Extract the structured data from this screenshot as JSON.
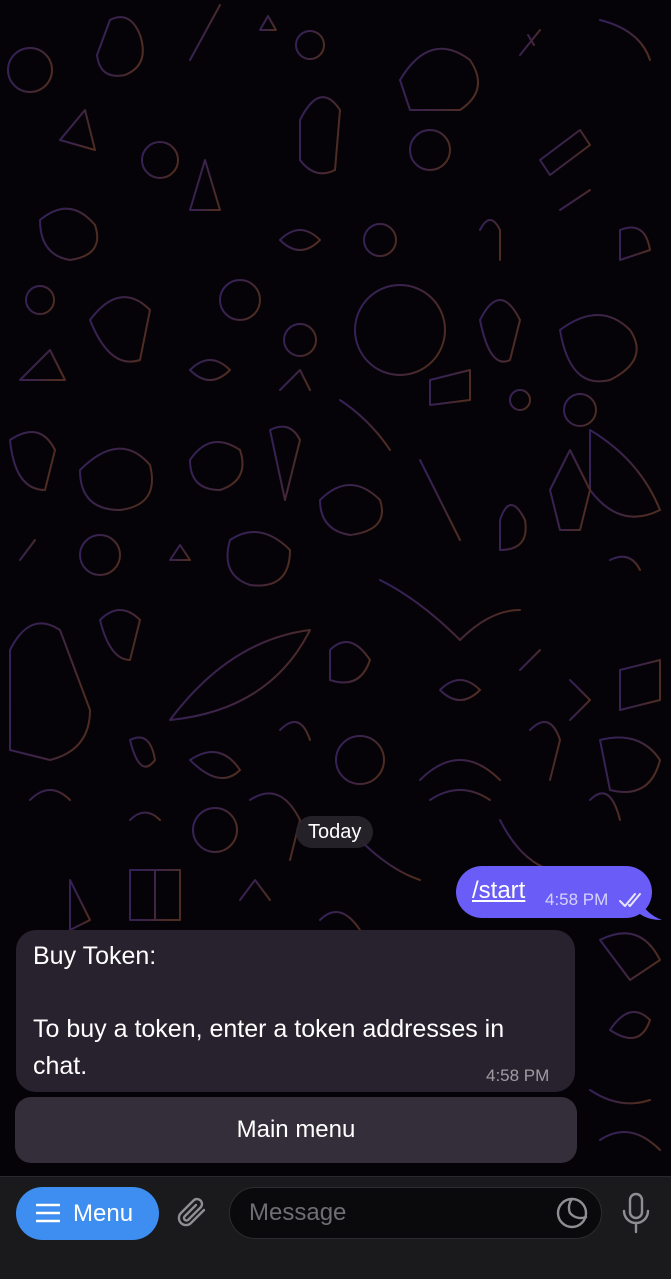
{
  "chat": {
    "date_separator": "Today",
    "outgoing": {
      "text": "/start",
      "time": "4:58 PM",
      "status_icon": "double-check-icon"
    },
    "incoming": {
      "line1": "Buy Token:",
      "line2": "To buy a token, enter a token addresses in",
      "line3": "chat.",
      "time": "4:58 PM"
    },
    "inline_keyboard": {
      "button_label": "Main menu"
    }
  },
  "input_bar": {
    "menu_label": "Menu",
    "menu_icon": "hamburger-icon",
    "attach_icon": "paperclip-icon",
    "placeholder": "Message",
    "sticker_icon": "sticker-icon",
    "mic_icon": "microphone-icon"
  },
  "colors": {
    "outgoing_bubble": "#6a5cf6",
    "incoming_bubble": "#27222e",
    "menu_button": "#3d8ef0",
    "background": "#050307"
  }
}
